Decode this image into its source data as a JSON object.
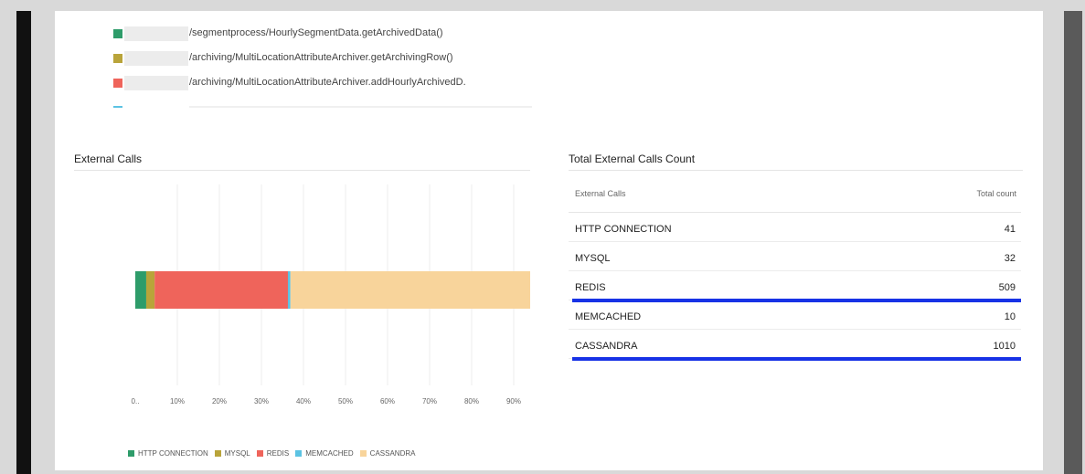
{
  "method_list": {
    "items": [
      {
        "color": "#2e9c6a",
        "text": "/segmentprocess/HourlySegmentData.getArchivedData()"
      },
      {
        "color": "#b9a43a",
        "text": "/archiving/MultiLocationAttributeArchiver.getArchivingRow()"
      },
      {
        "color": "#ef645b",
        "text": "/archiving/MultiLocationAttributeArchiver.addHourlyArchivedD."
      },
      {
        "color": "#5cc3e3",
        "text": ""
      }
    ]
  },
  "external_calls_section": {
    "title": "External Calls"
  },
  "total_section": {
    "title": "Total External Calls Count",
    "header_name": "External Calls",
    "header_count": "Total count",
    "rows": [
      {
        "name": "HTTP CONNECTION",
        "count": "41"
      },
      {
        "name": "MYSQL",
        "count": "32"
      },
      {
        "name": "REDIS",
        "count": "509",
        "highlighted": true
      },
      {
        "name": "MEMCACHED",
        "count": "10"
      },
      {
        "name": "CASSANDRA",
        "count": "1010",
        "highlighted": true
      }
    ]
  },
  "chart_data": {
    "type": "bar",
    "orientation": "horizontal",
    "stacked": true,
    "x_ticks": [
      "0..",
      "10%",
      "20%",
      "30%",
      "40%",
      "50%",
      "60%",
      "70%",
      "80%",
      "90%"
    ],
    "xlim": [
      0,
      100
    ],
    "grid": true,
    "legend_position": "bottom",
    "series": [
      {
        "name": "HTTP CONNECTION",
        "value": 2.6,
        "color": "#2e9c6a"
      },
      {
        "name": "MYSQL",
        "value": 2.0,
        "color": "#b9a43a"
      },
      {
        "name": "REDIS",
        "value": 31.7,
        "color": "#ef645b"
      },
      {
        "name": "MEMCACHED",
        "value": 0.6,
        "color": "#5cc3e3"
      },
      {
        "name": "CASSANDRA",
        "value": 63.1,
        "color": "#f8d49b"
      }
    ]
  }
}
